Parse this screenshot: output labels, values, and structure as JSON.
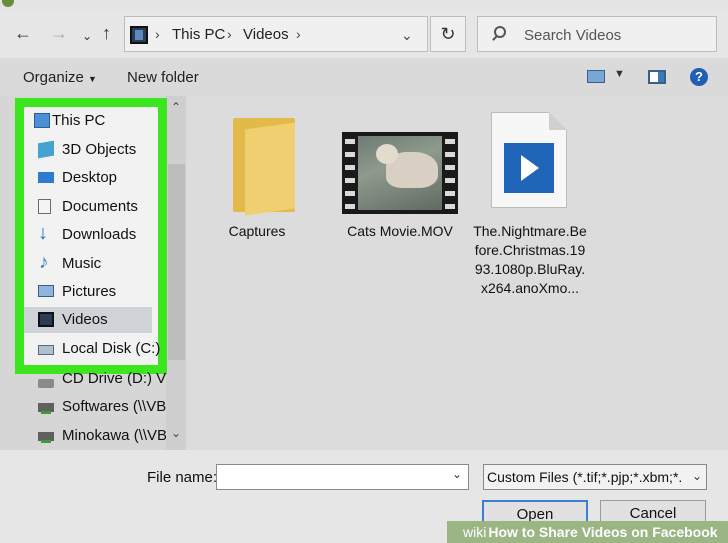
{
  "address": {
    "crumbs": [
      "This PC",
      "Videos"
    ],
    "search_placeholder": "Search Videos"
  },
  "commands": {
    "organize": "Organize",
    "new_folder": "New folder",
    "help": "?"
  },
  "nav": {
    "items": [
      {
        "label": "This PC",
        "icon": "pc-icon"
      },
      {
        "label": "3D Objects",
        "icon": "3d-objects-icon"
      },
      {
        "label": "Desktop",
        "icon": "desktop-icon"
      },
      {
        "label": "Documents",
        "icon": "documents-icon"
      },
      {
        "label": "Downloads",
        "icon": "downloads-icon"
      },
      {
        "label": "Music",
        "icon": "music-icon"
      },
      {
        "label": "Pictures",
        "icon": "pictures-icon"
      },
      {
        "label": "Videos",
        "icon": "videos-icon",
        "selected": true
      },
      {
        "label": "Local Disk (C:)",
        "icon": "local-disk-icon"
      },
      {
        "label": "CD Drive (D:) Vir",
        "icon": "cd-drive-icon"
      },
      {
        "label": "Softwares (\\\\VBc",
        "icon": "network-drive-icon"
      },
      {
        "label": "Minokawa (\\\\VBc",
        "icon": "network-drive-icon"
      }
    ],
    "highlight_color": "#3ce61e"
  },
  "files": [
    {
      "name": "Captures",
      "type": "folder"
    },
    {
      "name": "Cats Movie.MOV",
      "type": "video"
    },
    {
      "name": "The.Nightmare.Before.Christmas.1993.1080p.BluRay.x264.anoXmo...",
      "type": "movie-file"
    }
  ],
  "bottom": {
    "file_name_label": "File name:",
    "file_name_value": "",
    "file_type": "Custom Files (*.tif;*.pjp;*.xbm;*.",
    "open_label": "Open",
    "cancel_label": "Cancel"
  },
  "watermark": {
    "wiki": "wiki",
    "text": "How to Share Videos on Facebook"
  }
}
